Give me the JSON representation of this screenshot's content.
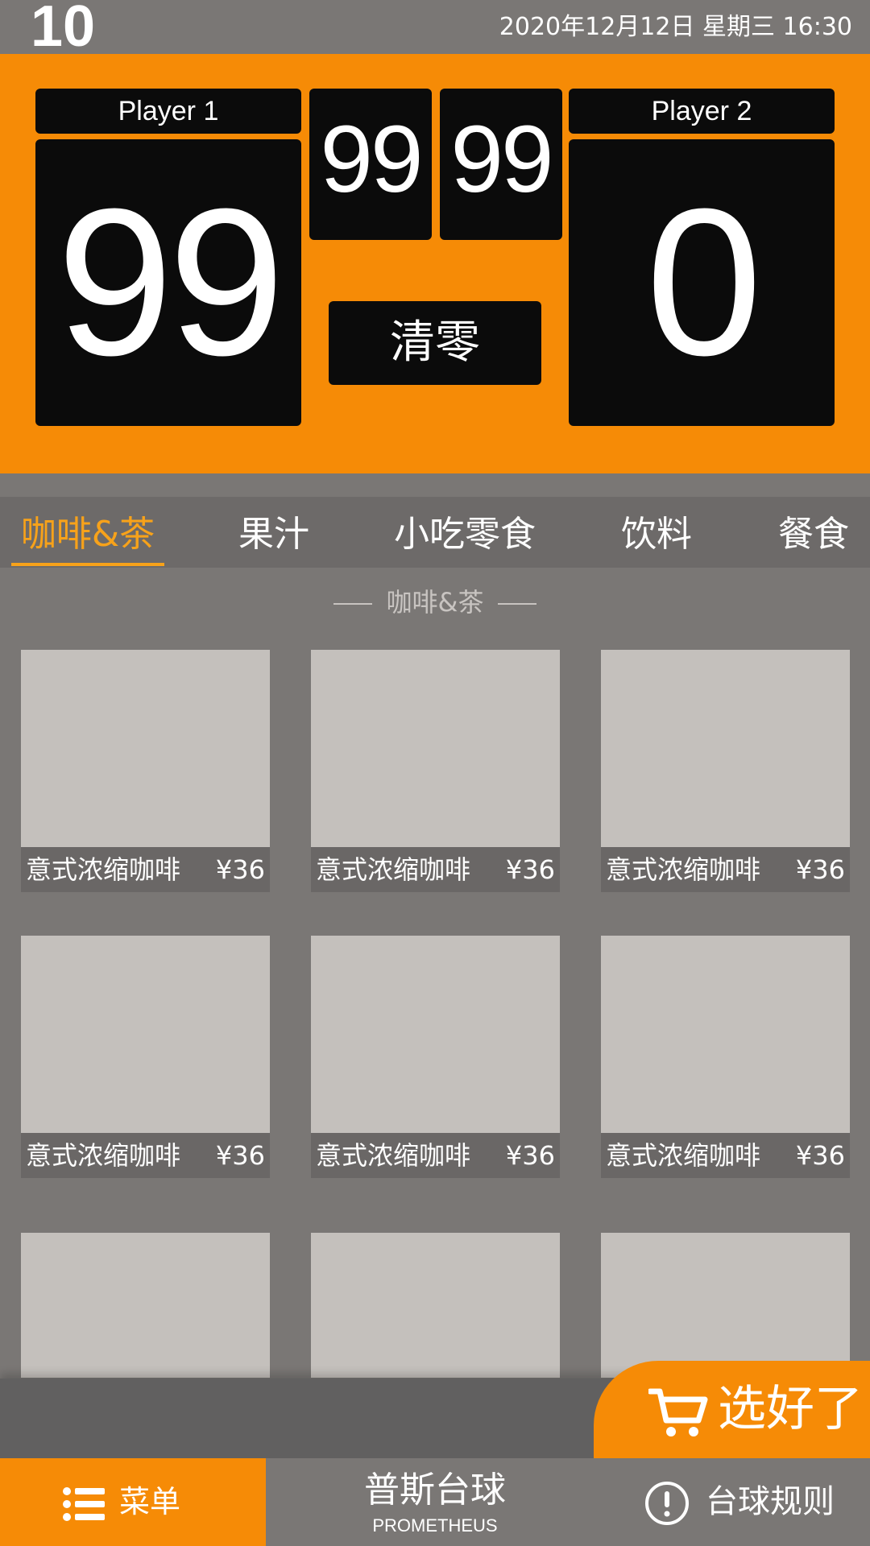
{
  "status": {
    "table_number": "10",
    "datetime": "2020年12月12日  星期三 16:30"
  },
  "scoreboard": {
    "player1": {
      "name": "Player 1",
      "score": "99"
    },
    "player2": {
      "name": "Player 2",
      "score": "0"
    },
    "mini_scores": [
      "99",
      "99"
    ],
    "clear_label": "清零"
  },
  "tabs": [
    {
      "label": "咖啡&茶",
      "active": true
    },
    {
      "label": "果汁",
      "active": false
    },
    {
      "label": "小吃零食",
      "active": false
    },
    {
      "label": "饮料",
      "active": false
    },
    {
      "label": "餐食",
      "active": false
    }
  ],
  "section_title": "咖啡&茶",
  "products": [
    {
      "name": "意式浓缩咖啡",
      "price": "¥36"
    },
    {
      "name": "意式浓缩咖啡",
      "price": "¥36"
    },
    {
      "name": "意式浓缩咖啡",
      "price": "¥36"
    },
    {
      "name": "意式浓缩咖啡",
      "price": "¥36"
    },
    {
      "name": "意式浓缩咖啡",
      "price": "¥36"
    },
    {
      "name": "意式浓缩咖啡",
      "price": "¥36"
    }
  ],
  "cart": {
    "checkout_label": "选好了",
    "icon": "cart-icon"
  },
  "bottom_nav": {
    "menu_label": "菜单",
    "menu_icon": "list-icon",
    "brand_cn": "普斯台球",
    "brand_en": "PROMETHEUS",
    "rules_label": "台球规则",
    "rules_icon": "info-icon"
  },
  "colors": {
    "accent": "#f68b06",
    "active_tab": "#f7a21a",
    "panel": "#0b0b0b",
    "background": "#7a7775"
  }
}
